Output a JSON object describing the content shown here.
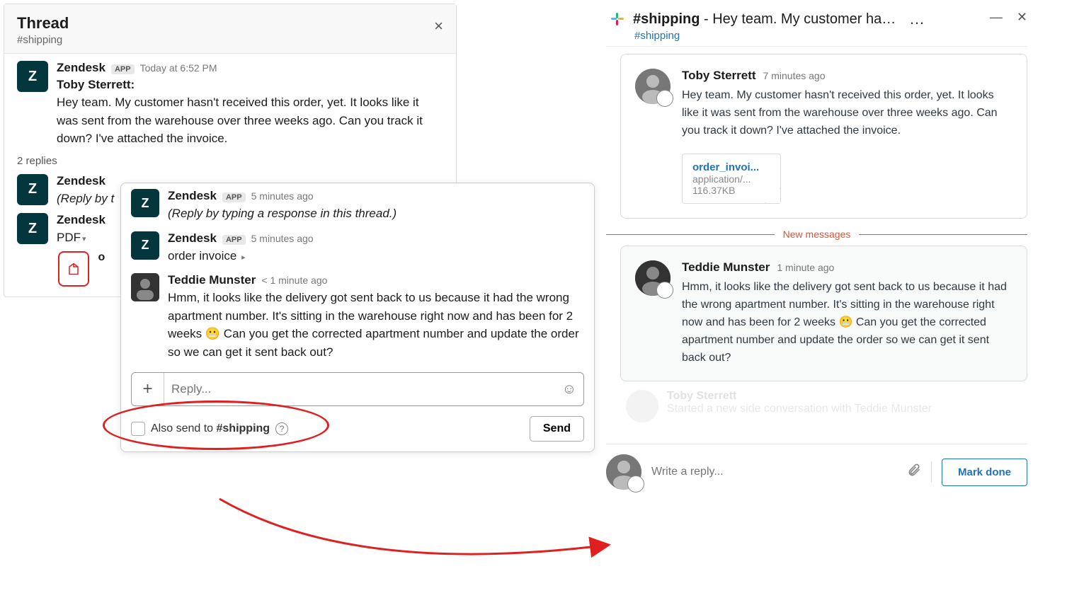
{
  "slack": {
    "thread_title": "Thread",
    "channel": "#shipping",
    "close_x": "×",
    "messages": {
      "first": {
        "author": "Zendesk",
        "badge": "APP",
        "time": "Today at 6:52 PM",
        "quote_name": "Toby Sterrett:",
        "text": "Hey team. My customer hasn't received this order, yet. It looks like it was sent from the warehouse over three weeks ago. Can you track it down? I've attached the invoice."
      },
      "reply_count": "2 replies",
      "bg1": {
        "author": "Zendesk",
        "text": "(Reply by t"
      },
      "bg2": {
        "author": "Zendesk",
        "text": "PDF"
      },
      "bg3_attach": "o"
    },
    "overlay": {
      "m1": {
        "author": "Zendesk",
        "badge": "APP",
        "time": "5 minutes ago",
        "text": "(Reply by typing a response in this thread.)"
      },
      "m2": {
        "author": "Zendesk",
        "badge": "APP",
        "time": "5 minutes ago",
        "text": "order invoice"
      },
      "m3": {
        "author": "Teddie Munster",
        "time": "< 1 minute ago",
        "text": "Hmm, it looks like the delivery got sent back to us because it had the wrong apartment number. It's sitting in the warehouse right now and has been for 2 weeks 😬 Can you get the corrected apartment number and update the order so we can get it sent back out?"
      },
      "reply_placeholder": "Reply...",
      "also_send_prefix": "Also send to ",
      "also_send_channel": "#shipping",
      "send_label": "Send"
    }
  },
  "zendesk": {
    "channel_name": "#shipping",
    "title_dash": " - ",
    "title_preview": "Hey team. My customer hasn't",
    "channel_link": "#shipping",
    "dots": "…",
    "card1": {
      "author": "Toby Sterrett",
      "time": "7 minutes ago",
      "text": "Hey team. My customer hasn't received this order, yet. It looks like it was sent from the warehouse over three weeks ago. Can you track it down? I've attached the invoice.",
      "attachment": {
        "name": "order_invoi...",
        "type": "application/...",
        "size": "116.37KB"
      }
    },
    "new_messages": "New messages",
    "card2": {
      "author": "Teddie Munster",
      "time": "1 minute ago",
      "text": "Hmm, it looks like the delivery got sent back to us because it had the wrong apartment number. It's sitting in the warehouse right now and has been for 2 weeks 😬 Can you get the corrected apartment number and update the order so we can get it sent back out?"
    },
    "reply_placeholder": "Write a reply...",
    "mark_done": "Mark done"
  }
}
